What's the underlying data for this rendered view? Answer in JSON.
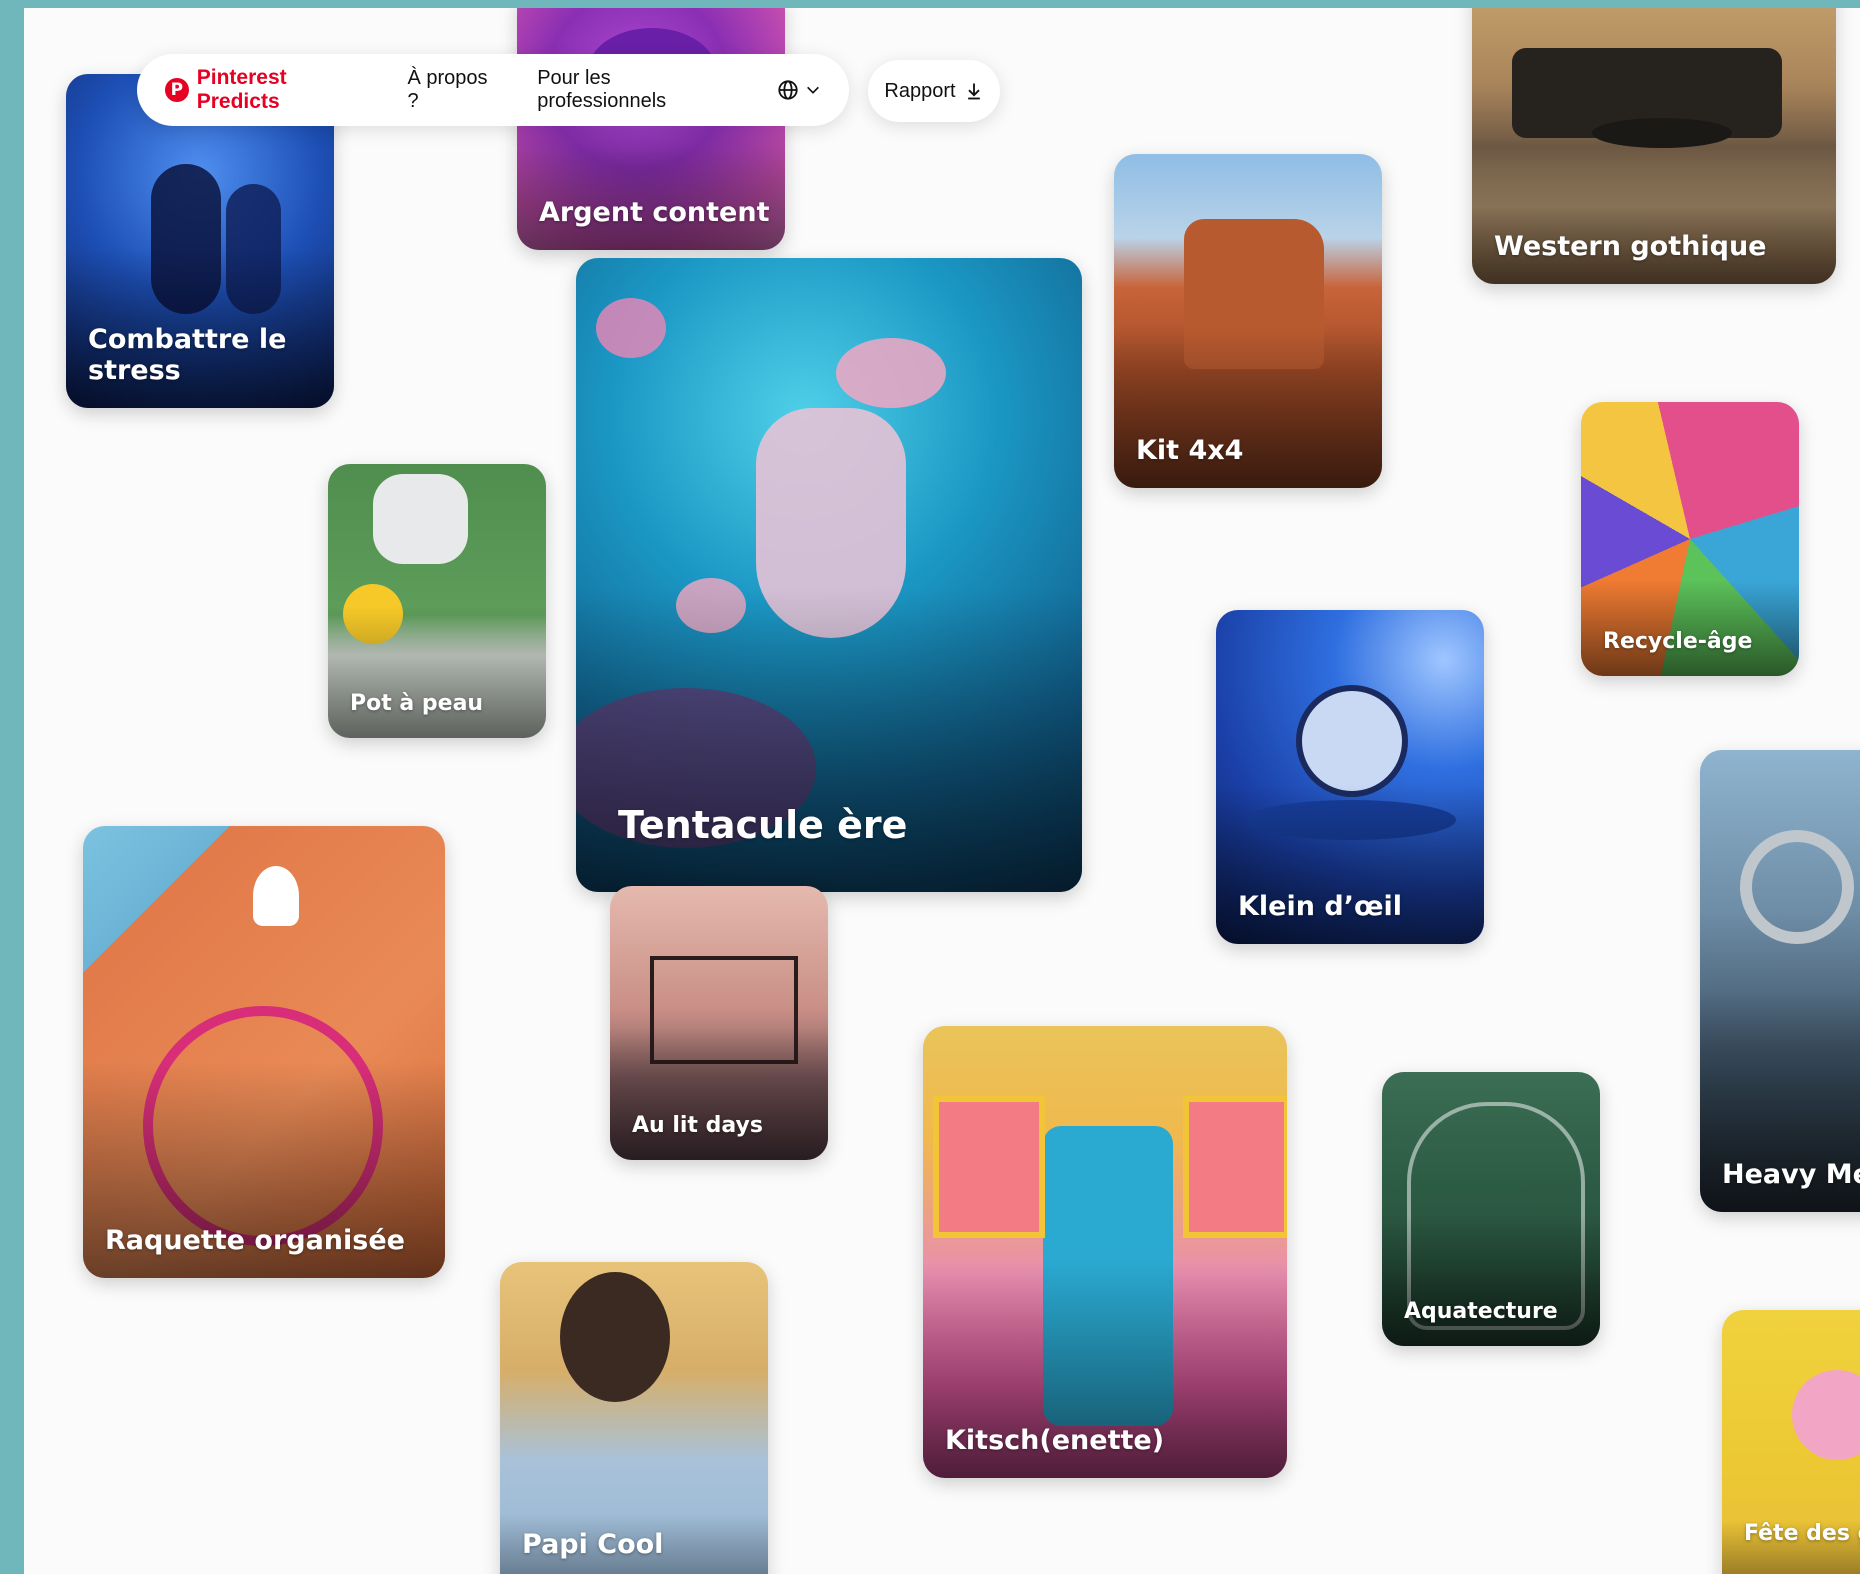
{
  "nav": {
    "brand": "Pinterest Predicts",
    "brand_icon": "pinterest-p-icon",
    "about": "À propos ?",
    "business": "Pour les professionnels",
    "language_icon": "globe-icon",
    "report": "Rapport",
    "report_icon": "download-icon"
  },
  "trends": [
    {
      "label": "Combattre le stress"
    },
    {
      "label": "Argent content"
    },
    {
      "label": "Tentacule ère"
    },
    {
      "label": "Kit 4x4"
    },
    {
      "label": "Western gothique"
    },
    {
      "label": "Pot à peau"
    },
    {
      "label": "Recycle-âge"
    },
    {
      "label": "Klein d’œil"
    },
    {
      "label": "Raquette organisée"
    },
    {
      "label": "Au lit days"
    },
    {
      "label": "Kitsch(enette)"
    },
    {
      "label": "Aquatecture"
    },
    {
      "label": "Heavy Me"
    },
    {
      "label": "Papi Cool"
    },
    {
      "label": "Fête des go"
    }
  ],
  "colors": {
    "brand_red": "#e60023",
    "frame": "#6fb7bb"
  }
}
